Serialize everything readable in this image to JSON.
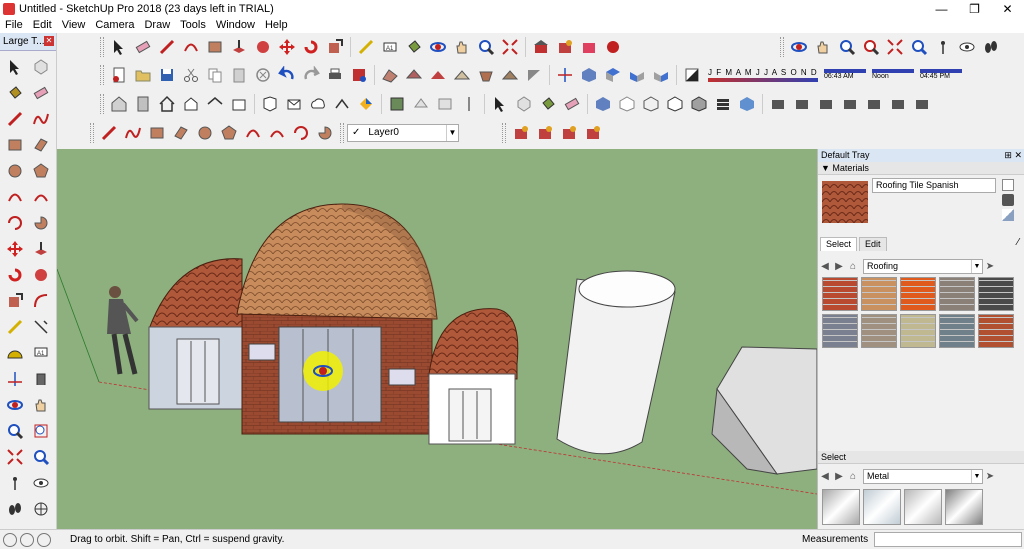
{
  "window": {
    "title": "Untitled - SketchUp Pro 2018 (23 days left in TRIAL)",
    "minimize": "—",
    "maximize": "❐",
    "close": "✕"
  },
  "menu": [
    "File",
    "Edit",
    "View",
    "Camera",
    "Draw",
    "Tools",
    "Window",
    "Help"
  ],
  "left_panel": {
    "title": "Large T..."
  },
  "layer": {
    "current": "Layer0",
    "check": "✓"
  },
  "shadows": {
    "months": "J F M A M J J A S O N D",
    "time_start": "06:43 AM",
    "time_mid": "Noon",
    "time_end": "04:45 PM"
  },
  "tray": {
    "title": "Default Tray",
    "materials_section": "Materials",
    "material_name": "Roofing Tile Spanish",
    "tab_select": "Select",
    "tab_edit": "Edit",
    "collection_1": "Roofing",
    "select_section_2": "Select",
    "collection_2": "Metal",
    "swatch_colors": [
      "#b94a30",
      "#c99060",
      "#e05a1e",
      "#8a8078",
      "#4a4a4a",
      "#7a8090",
      "#a09080",
      "#c0b890",
      "#70808a",
      "#b05030"
    ],
    "metal_colors": [
      "#a8a8a8",
      "#c0ccd4",
      "#b8b8b8",
      "#808080"
    ]
  },
  "status": {
    "message": "Drag to orbit. Shift = Pan, Ctrl = suspend gravity.",
    "measurements_label": "Measurements"
  },
  "colors": {
    "viewport": "#8eaf7e",
    "brick": "#9a4a30",
    "roof_tile": "#b05a38",
    "dome": "#c88a5a",
    "highlight": "#f0f000"
  }
}
